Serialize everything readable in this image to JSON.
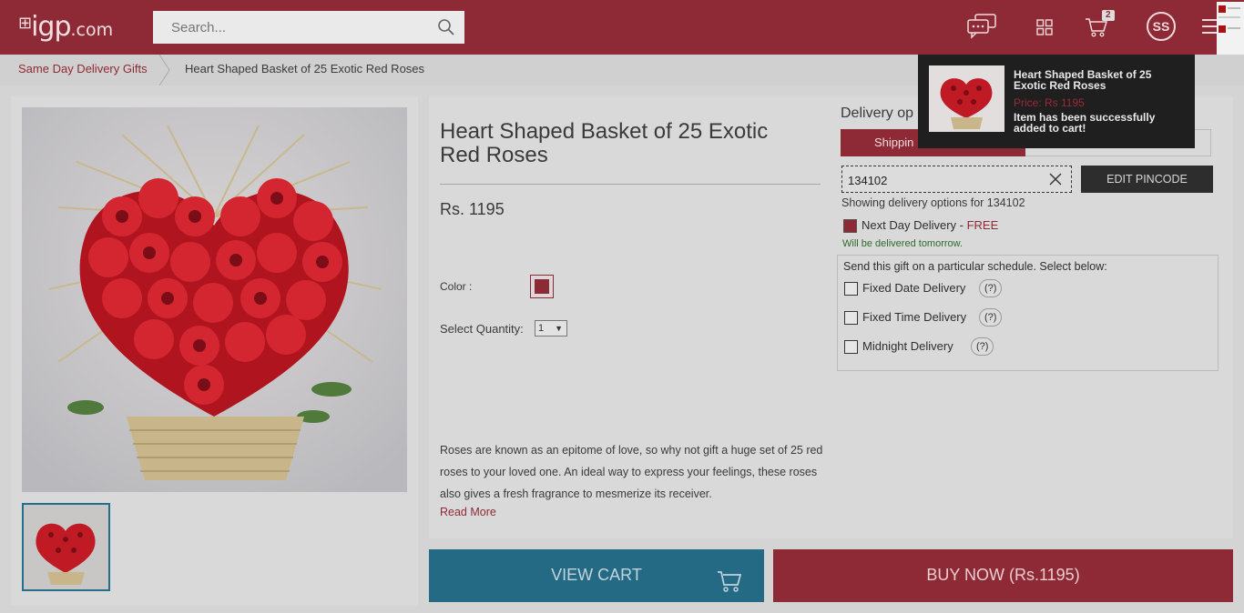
{
  "header": {
    "logo_main": "igp",
    "logo_domain": ".com",
    "search_placeholder": "Search...",
    "cart_count": "2",
    "avatar_initials": "SS"
  },
  "breadcrumb": {
    "parent": "Same Day Delivery Gifts",
    "current": "Heart Shaped Basket of 25 Exotic Red Roses"
  },
  "product": {
    "title": "Heart Shaped Basket of 25 Exotic Red Roses",
    "price": "Rs. 1195",
    "color_label": "Color :",
    "color_value": "#8e2a35",
    "quantity_label": "Select Quantity:",
    "quantity_value": "1",
    "description": "Roses are known as an epitome of love, so why not gift a huge set of 25 red roses to your loved one. An ideal way to express your feelings, these roses also gives a fresh fragrance to mesmerize its receiver.",
    "read_more": "Read More"
  },
  "delivery": {
    "title": "Delivery op",
    "tab_shipping": "Shippin",
    "pincode": "134102",
    "edit_pincode": "EDIT PINCODE",
    "showing_text": "Showing delivery options for 134102",
    "next_day_label": "Next Day Delivery",
    "next_day_sep": " - ",
    "next_day_price": "FREE",
    "delivery_note": "Will be delivered tomorrow.",
    "schedule_title": "Send this gift on a particular schedule. Select below:",
    "options": [
      {
        "label": "Fixed Date Delivery",
        "help": "(?)"
      },
      {
        "label": "Fixed Time Delivery",
        "help": "(?)"
      },
      {
        "label": "Midnight Delivery",
        "help": "(?)"
      }
    ]
  },
  "actions": {
    "view_cart": "VIEW CART",
    "buy_now": "BUY NOW (Rs.1195)"
  },
  "toast": {
    "product_name": "Heart Shaped Basket of 25 Exotic Red Roses",
    "price": "Price: Rs 1195",
    "message": "Item has been successfully added to cart!"
  },
  "colors": {
    "brand": "#8e2a35",
    "view_cart": "#246a85",
    "toast_bg": "#1f1f1f"
  }
}
